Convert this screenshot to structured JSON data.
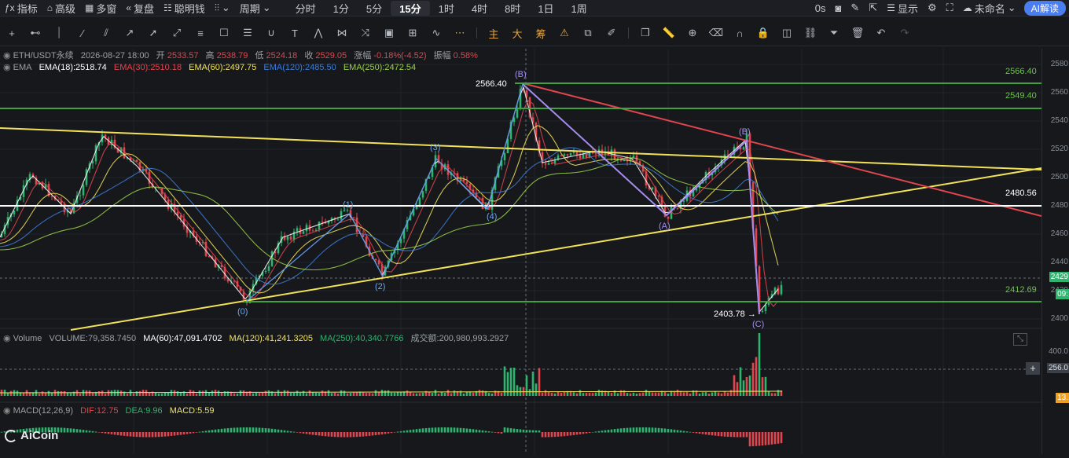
{
  "toolbar": {
    "indicator": "指标",
    "advanced": "高级",
    "multi_window": "多窗",
    "replay": "复盘",
    "smart_money": "聪明钱",
    "period_label": "周期",
    "timeframes": [
      "分时",
      "1分",
      "5分",
      "15分",
      "1时",
      "4时",
      "8时",
      "1日",
      "1周"
    ],
    "active_timeframe": "15分",
    "countdown": "0s",
    "display": "显示",
    "layout_name": "未命名",
    "ai_button": "AI解读"
  },
  "drawing_tools": {
    "main_label": "主",
    "big_label": "大",
    "chip_label": "筹"
  },
  "info_bar": {
    "symbol": "ETH/USDT永续",
    "datetime": "2026-08-27 18:00",
    "open_label": "开",
    "open": "2533.57",
    "high_label": "高",
    "high": "2538.79",
    "low_label": "低",
    "low": "2524.18",
    "close_label": "收",
    "close": "2529.05",
    "change_label": "涨幅",
    "change": "-0.18%(-4.52)",
    "amplitude_label": "振幅",
    "amplitude": "0.58%"
  },
  "ema": {
    "label": "EMA",
    "ema18": "EMA(18):2518.74",
    "ema30": "EMA(30):2510.18",
    "ema60": "EMA(60):2497.75",
    "ema120": "EMA(120):2485.50",
    "ema250": "EMA(250):2472.54"
  },
  "volume": {
    "label": "Volume",
    "volume": "VOLUME:79,358.7450",
    "ma60": "MA(60):47,091.4702",
    "ma120": "MA(120):41,241.3205",
    "ma250": "MA(250):40,340.7766",
    "turnover": "成交额:200,980,993.2927"
  },
  "macd": {
    "label": "MACD(12,26,9)",
    "dif": "DIF:12.75",
    "dea": "DEA:9.96",
    "macd": "MACD:5.59"
  },
  "price_axis": {
    "ticks": [
      "2580",
      "2560",
      "2540",
      "2520",
      "2500",
      "2480",
      "2460",
      "2440",
      "2420",
      "2400"
    ],
    "current_price": "2429",
    "countdown": "09:",
    "level_2566": "2566.40",
    "level_2549": "2549.40",
    "level_2412": "2412.69",
    "volume_ticks": [
      "400.0",
      "256.0",
      "13."
    ]
  },
  "annotations": {
    "high_price": "2566.40",
    "low_price": "2403.78 →",
    "line_label": "2480.56",
    "wave_labels": [
      "(0)",
      "(1)",
      "(2)",
      "(3)",
      "(4)",
      "(B)",
      "(A)",
      "(B)",
      "(C)"
    ]
  },
  "logo": "AiCoin",
  "colors": {
    "background": "#16181c",
    "up": "#2db46e",
    "down": "#e0464d",
    "accent": "#4a7df0",
    "ema18": "#ffffff",
    "ema30": "#e0464d",
    "ema60": "#f2e25a",
    "ema120": "#3e7bd6",
    "ema250": "#9bd04a"
  }
}
